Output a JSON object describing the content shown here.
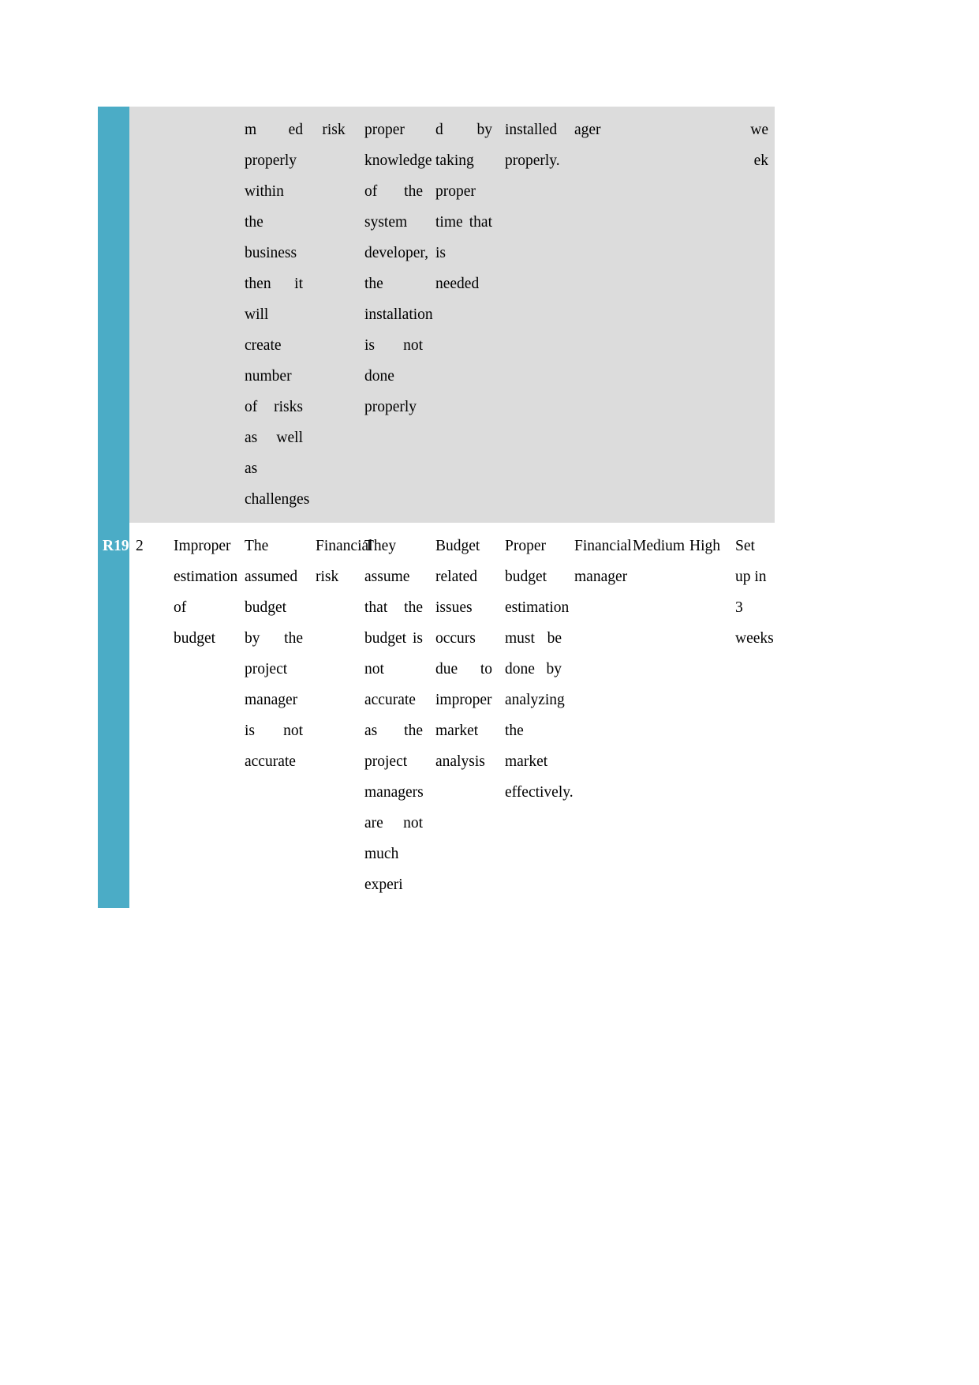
{
  "document": {
    "table": {
      "columns": [
        "id",
        "no",
        "risk_name",
        "cause",
        "type",
        "description",
        "impact",
        "response",
        "owner",
        "probability",
        "severity",
        "timeline"
      ],
      "rows": [
        {
          "kind": "continuation",
          "id": "",
          "no": "",
          "risk_name": "",
          "cause": "m ed properly within the business then it will create number of risks as well as challenges",
          "type": "risk",
          "description": "proper knowledge of the system developer, the installation is not done properly",
          "impact": "d by taking proper time that is needed",
          "response": "installed properly.",
          "owner": "ager",
          "probability": "",
          "severity": "",
          "timeline": "we ek"
        },
        {
          "kind": "data",
          "id": "R19",
          "no": "2",
          "risk_name": "Improper estimation of budget",
          "cause": "The assumed budget by the project manager is not accurate",
          "type": "Financial risk",
          "description": "They assume that the budget is not accurate as the project managers are not much experi",
          "impact": "Budget related issues occurs due to improper market analysis",
          "response": "Proper budget estimation must be done by analyzing the market effectively.",
          "owner": "Financial manager",
          "probability": "Medium",
          "severity": "High",
          "timeline": "Set up in 3 weeks"
        }
      ]
    }
  }
}
